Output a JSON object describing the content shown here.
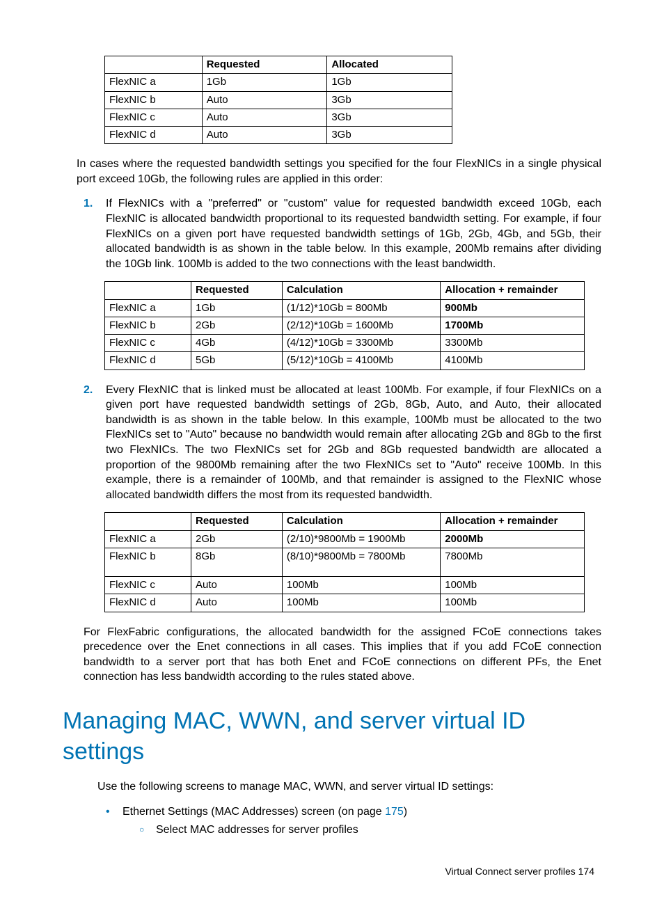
{
  "table1": {
    "headers": [
      "",
      "Requested",
      "Allocated"
    ],
    "rows": [
      {
        "c0": "FlexNIC a",
        "c1": "1Gb",
        "c2": "1Gb"
      },
      {
        "c0": "FlexNIC b",
        "c1": "Auto",
        "c2": "3Gb"
      },
      {
        "c0": "FlexNIC c",
        "c1": "Auto",
        "c2": "3Gb"
      },
      {
        "c0": "FlexNIC d",
        "c1": "Auto",
        "c2": "3Gb"
      }
    ]
  },
  "para1": "In cases where the requested bandwidth settings you specified for the four FlexNICs in a single physical port exceed 10Gb, the following rules are applied in this order:",
  "ol1": {
    "num": "1.",
    "text": "If FlexNICs with a \"preferred\" or \"custom\" value for requested bandwidth exceed 10Gb, each FlexNIC is allocated bandwidth proportional to its requested bandwidth setting. For example, if four FlexNICs on a given port have requested bandwidth settings of 1Gb, 2Gb, 4Gb, and 5Gb, their allocated bandwidth is as shown in the table below. In this example, 200Mb remains after dividing the 10Gb link. 100Mb is added to the two connections with the least bandwidth."
  },
  "table2": {
    "headers": [
      "",
      "Requested",
      "Calculation",
      "Allocation + remainder"
    ],
    "rows": [
      {
        "c0": "FlexNIC a",
        "c1": "1Gb",
        "c2": "(1/12)*10Gb = 800Mb",
        "c3": "900Mb",
        "bold": true
      },
      {
        "c0": "FlexNIC b",
        "c1": "2Gb",
        "c2": "(2/12)*10Gb = 1600Mb",
        "c3": "1700Mb",
        "bold": true
      },
      {
        "c0": "FlexNIC c",
        "c1": "4Gb",
        "c2": "(4/12)*10Gb = 3300Mb",
        "c3": "3300Mb",
        "bold": false
      },
      {
        "c0": "FlexNIC d",
        "c1": "5Gb",
        "c2": "(5/12)*10Gb = 4100Mb",
        "c3": "4100Mb",
        "bold": false
      }
    ]
  },
  "ol2": {
    "num": "2.",
    "text": "Every FlexNIC that is linked must be allocated at least 100Mb. For example, if four FlexNICs on a given port have requested bandwidth settings of 2Gb, 8Gb, Auto, and Auto, their allocated bandwidth is as shown in the table below. In this example, 100Mb must be allocated to the two FlexNICs set to \"Auto\" because no bandwidth would remain after allocating 2Gb and 8Gb to the first two FlexNICs. The two FlexNICs set for 2Gb and 8Gb requested bandwidth are allocated a proportion of the 9800Mb remaining after the two FlexNICs set to \"Auto\" receive 100Mb. In this example, there is a remainder of 100Mb, and that remainder is assigned to the FlexNIC whose allocated bandwidth differs the most from its requested bandwidth."
  },
  "table3": {
    "headers": [
      "",
      "Requested",
      "Calculation",
      "Allocation + remainder"
    ],
    "rows": [
      {
        "c0": "FlexNIC a",
        "c1": "2Gb",
        "c2": "(2/10)*9800Mb = 1900Mb",
        "c3": "2000Mb",
        "bold": true,
        "pad": false
      },
      {
        "c0": "FlexNIC b",
        "c1": "8Gb",
        "c2": "(8/10)*9800Mb = 7800Mb",
        "c3": "7800Mb",
        "bold": false,
        "pad": true
      },
      {
        "c0": "FlexNIC c",
        "c1": "Auto",
        "c2": "100Mb",
        "c3": "100Mb",
        "bold": false,
        "pad": false
      },
      {
        "c0": "FlexNIC d",
        "c1": "Auto",
        "c2": "100Mb",
        "c3": "100Mb",
        "bold": false,
        "pad": false
      }
    ]
  },
  "para2": "For FlexFabric configurations, the allocated bandwidth for the assigned FCoE connections takes precedence over the Enet connections in all cases. This implies that if you add FCoE connection bandwidth to a server port that has both Enet and FCoE connections on different PFs, the Enet connection has less bandwidth according to the rules stated above.",
  "heading": "Managing MAC, WWN, and server virtual ID settings",
  "para3": "Use the following screens to manage MAC, WWN, and server virtual ID settings:",
  "bullet1_pre": "Ethernet Settings (MAC Addresses) screen (on page ",
  "bullet1_link": "175",
  "bullet1_post": ")",
  "sub1": "Select MAC addresses for server profiles",
  "footer": "Virtual Connect server profiles   174"
}
